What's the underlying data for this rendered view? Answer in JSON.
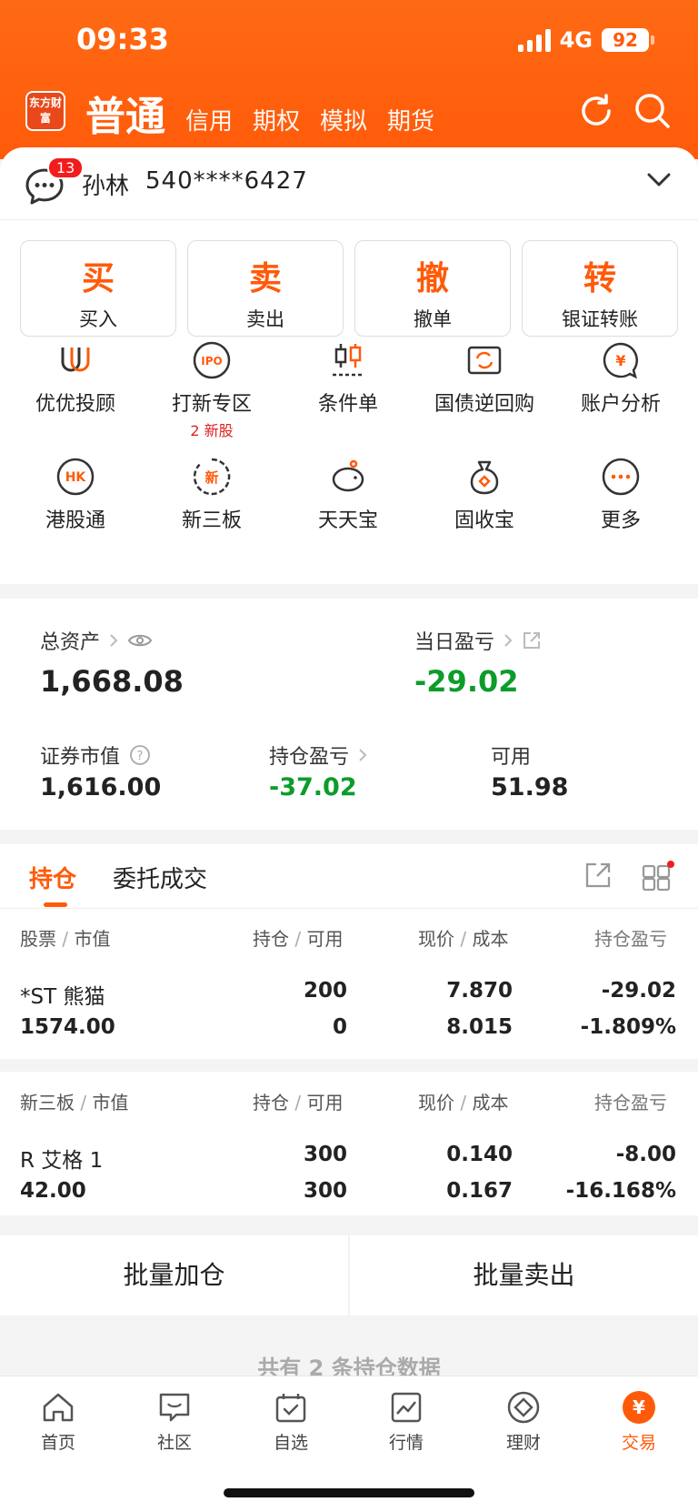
{
  "status_bar": {
    "time": "09:33",
    "network": "4G",
    "battery": "92"
  },
  "header": {
    "logo_text": "东方财富",
    "tabs": [
      {
        "label": "普通",
        "active": true
      },
      {
        "label": "信用"
      },
      {
        "label": "期权"
      },
      {
        "label": "模拟"
      },
      {
        "label": "期货"
      }
    ],
    "icons": [
      "refresh-icon",
      "search-icon"
    ]
  },
  "account": {
    "message_count": "13",
    "name": "孙林",
    "number": "540****6427"
  },
  "actions": [
    {
      "big": "买",
      "label": "买入"
    },
    {
      "big": "卖",
      "label": "卖出"
    },
    {
      "big": "撤",
      "label": "撤单"
    },
    {
      "big": "转",
      "label": "银证转账"
    }
  ],
  "grid": [
    {
      "label": "优优投顾",
      "icon": "advisor-icon"
    },
    {
      "label": "打新专区",
      "icon": "ipo-icon",
      "sub": "2 新股"
    },
    {
      "label": "条件单",
      "icon": "conditional-order-icon"
    },
    {
      "label": "国债逆回购",
      "icon": "bond-repo-icon"
    },
    {
      "label": "账户分析",
      "icon": "account-analysis-icon"
    },
    {
      "label": "港股通",
      "icon": "hk-icon"
    },
    {
      "label": "新三板",
      "icon": "neeq-icon"
    },
    {
      "label": "天天宝",
      "icon": "piggy-bank-icon"
    },
    {
      "label": "固收宝",
      "icon": "money-bag-icon"
    },
    {
      "label": "更多",
      "icon": "more-icon"
    }
  ],
  "assets": {
    "total_label": "总资产",
    "total_value": "1,668.08",
    "daily_label": "当日盈亏",
    "daily_value": "-29.02",
    "market_label": "证券市值",
    "market_value": "1,616.00",
    "position_pl_label": "持仓盈亏",
    "position_pl_value": "-37.02",
    "available_label": "可用",
    "available_value": "51.98"
  },
  "holdings": {
    "tab_active": "持仓",
    "tab_other": "委托成交",
    "sections": [
      {
        "header": [
          "股票",
          "市值",
          "持仓",
          "可用",
          "现价",
          "成本",
          "持仓盈亏"
        ],
        "rows": [
          {
            "name": "*ST 熊猫",
            "market_value": "1574.00",
            "position": "200",
            "available": "0",
            "price": "7.870",
            "cost": "8.015",
            "pl": "-29.02",
            "pl_pct": "-1.809%"
          }
        ]
      },
      {
        "header": [
          "新三板",
          "市值",
          "持仓",
          "可用",
          "现价",
          "成本",
          "持仓盈亏"
        ],
        "rows": [
          {
            "name": "R 艾格 1",
            "market_value": "42.00",
            "position": "300",
            "available": "300",
            "price": "0.140",
            "cost": "0.167",
            "pl": "-8.00",
            "pl_pct": "-16.168%"
          }
        ]
      }
    ]
  },
  "batch": {
    "add": "批量加仓",
    "sell": "批量卖出"
  },
  "footer_count": "共有 2 条持仓数据",
  "nav": [
    {
      "label": "首页",
      "icon": "home-icon"
    },
    {
      "label": "社区",
      "icon": "community-icon"
    },
    {
      "label": "自选",
      "icon": "watchlist-icon"
    },
    {
      "label": "行情",
      "icon": "market-icon"
    },
    {
      "label": "理财",
      "icon": "wealth-icon"
    },
    {
      "label": "交易",
      "icon": "trade-icon",
      "active": true
    }
  ],
  "colors": {
    "brand": "#ff5a0a",
    "loss_green": "#0d9c2a",
    "badge_red": "#f21c1c"
  }
}
